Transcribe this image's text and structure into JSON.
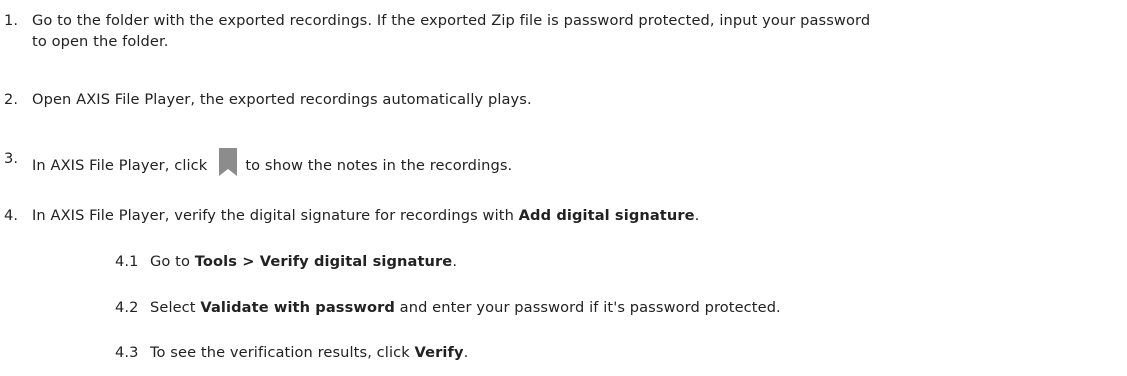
{
  "steps": [
    {
      "num": "1.",
      "line1": "Go to the folder with the exported recordings. If the exported Zip file is password protected, input your password",
      "line2": "to open the folder."
    },
    {
      "num": "2.",
      "text": "Open AXIS File Player, the exported recordings automatically plays."
    },
    {
      "num": "3.",
      "before_icon": "In AXIS File Player, click",
      "icon": "bookmark-icon",
      "after_icon": "to show the notes in the recordings."
    },
    {
      "num": "4.",
      "before_bold": "In AXIS File Player, verify the digital signature for recordings with ",
      "bold": "Add digital signature",
      "after_bold": ".",
      "substeps": [
        {
          "num": "4.1",
          "before_bold": "Go to ",
          "bold": "Tools > Verify digital signature",
          "after_bold": "."
        },
        {
          "num": "4.2",
          "before_bold": "Select ",
          "bold": "Validate with password",
          "after_bold": " and enter your password if it's password protected."
        },
        {
          "num": "4.3",
          "before_bold": "To see the verification results, click ",
          "bold": "Verify",
          "after_bold": "."
        }
      ]
    }
  ],
  "colors": {
    "text": "#222222",
    "icon": "#8c8c8c"
  }
}
